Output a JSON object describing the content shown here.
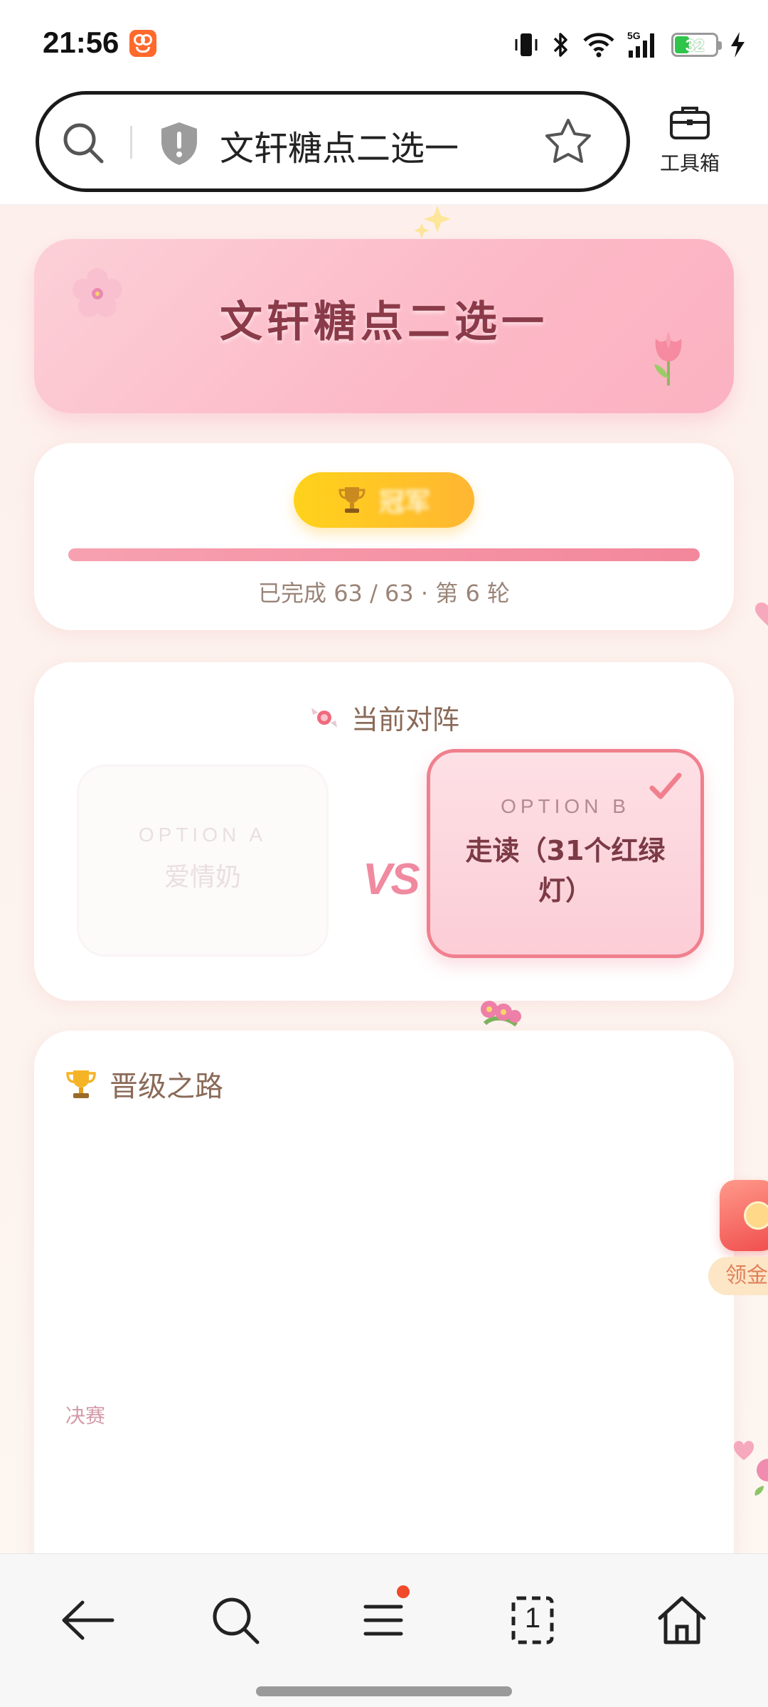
{
  "status_bar": {
    "time": "21:56",
    "battery_level": "32",
    "icons": [
      "app-badge-icon",
      "vibrate-icon",
      "bluetooth-icon",
      "wifi-icon",
      "signal-5g-icon",
      "battery-icon",
      "charging-icon"
    ]
  },
  "browser": {
    "url_text": "文轩糖点二选一",
    "toolbox_label": "工具箱"
  },
  "hero": {
    "title": "文轩糖点二选一"
  },
  "progress": {
    "champion_label": "冠军",
    "progress_text": "已完成 63 / 63 · 第 6 轮",
    "completed": 63,
    "total": 63
  },
  "match": {
    "title": "当前对阵",
    "option_a": {
      "label": "OPTION A",
      "name": "爱情奶"
    },
    "vs_label": "VS",
    "option_b": {
      "label": "OPTION B",
      "name": "走读（31个红绿灯）",
      "selected": true
    }
  },
  "bracket": {
    "title": "晋级之路",
    "final_label": "决赛"
  },
  "floating": {
    "redpacket_label": "领金"
  },
  "nav": {
    "items": [
      "back-icon",
      "search-icon",
      "menu-icon",
      "tabs-icon",
      "home-icon"
    ],
    "tab_count": "1"
  },
  "colors": {
    "accent_pink": "#f0808e",
    "champion_gold": "#ffc21f",
    "title_text": "#8a3a48",
    "page_background": "#fdf3ef"
  }
}
